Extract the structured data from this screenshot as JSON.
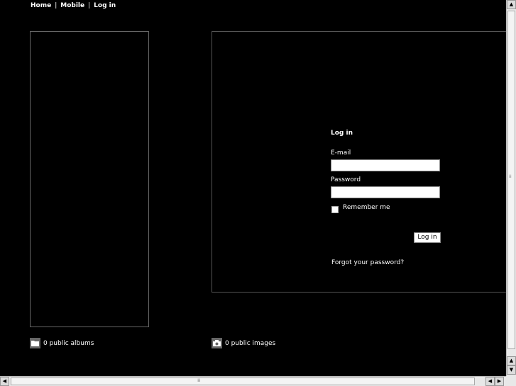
{
  "nav": {
    "home": "Home",
    "mobile": "Mobile",
    "login": "Log in",
    "separator": "|"
  },
  "login": {
    "title": "Log in",
    "email_label": "E-mail",
    "email_value": "",
    "password_label": "Password",
    "password_value": "",
    "remember_label": "Remember me",
    "remember_checked": false,
    "submit_label": "Log in",
    "forgot_link": "Forgot your password?"
  },
  "stats": {
    "albums": "0 public albums",
    "albums_icon": "folder-icon",
    "images": "0 public images",
    "images_icon": "camera-icon"
  },
  "colors": {
    "background": "#000000",
    "text": "#ffffff",
    "panel_border": "#666666"
  }
}
